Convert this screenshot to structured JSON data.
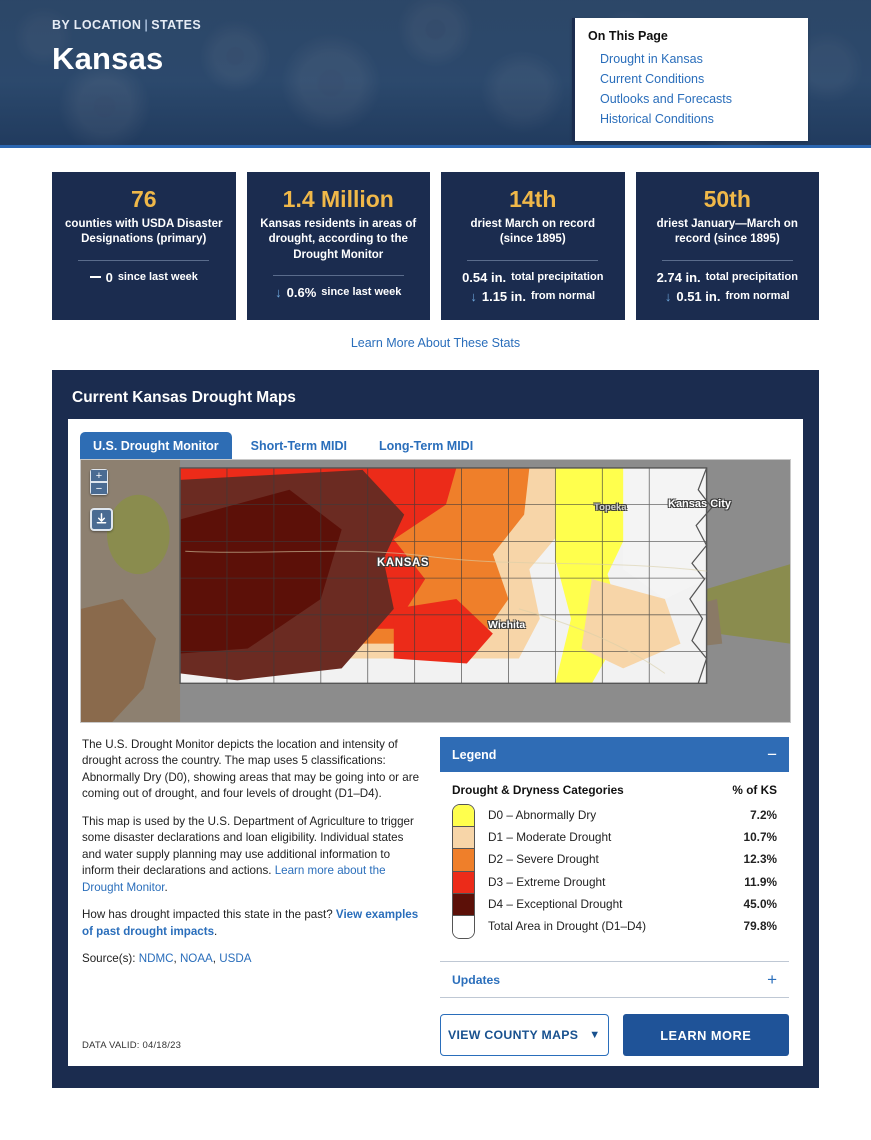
{
  "hero": {
    "eyebrow_a": "BY LOCATION",
    "eyebrow_sep": "|",
    "eyebrow_b": "STATES",
    "title": "Kansas",
    "on_this_page": {
      "title": "On This Page",
      "links": [
        "Drought in Kansas",
        "Current Conditions",
        "Outlooks and Forecasts",
        "Historical Conditions"
      ]
    }
  },
  "stats": {
    "cards": [
      {
        "number": "76",
        "label": "counties with USDA Disaster Designations (primary)",
        "rows": [
          {
            "icon": "no-change-dash",
            "value": "0",
            "sub": "since last week"
          }
        ]
      },
      {
        "number": "1.4 Million",
        "label": "Kansas residents in areas of drought, according to the Drought Monitor",
        "rows": [
          {
            "icon": "arrow-down",
            "value": "0.6%",
            "sub": "since last week"
          }
        ]
      },
      {
        "number": "14th",
        "label": "driest March on record (since 1895)",
        "rows": [
          {
            "icon": "none",
            "value": "0.54 in.",
            "sub": "total precipitation"
          },
          {
            "icon": "arrow-down",
            "value": "1.15 in.",
            "sub": "from normal"
          }
        ]
      },
      {
        "number": "50th",
        "label": "driest January—March on record (since 1895)",
        "rows": [
          {
            "icon": "none",
            "value": "2.74 in.",
            "sub": "total precipitation"
          },
          {
            "icon": "arrow-down",
            "value": "0.51 in.",
            "sub": "from normal"
          }
        ]
      }
    ],
    "learn_more_link": "Learn More About These Stats"
  },
  "map_card": {
    "title": "Current Kansas Drought Maps",
    "tabs": [
      {
        "label": "U.S. Drought Monitor",
        "active": true
      },
      {
        "label": "Short-Term MIDI",
        "active": false
      },
      {
        "label": "Long-Term MIDI",
        "active": false
      }
    ],
    "map": {
      "zoom_in": "+",
      "zoom_out": "−",
      "state_label": "KANSAS",
      "city_labels": [
        "Topeka",
        "Wichita",
        "Kansas City"
      ]
    },
    "paragraphs": {
      "p1": "The U.S. Drought Monitor depicts the location and intensity of drought across the country. The map uses 5 classifications: Abnormally Dry (D0), showing areas that may be going into or are coming out of drought, and four levels of drought (D1–D4).",
      "p2_a": "This map is used by the U.S. Department of Agriculture to trigger some disaster declarations and loan eligibility. Individual states and water supply planning may use additional information to inform their declarations and actions. ",
      "p2_link": "Learn more about the Drought Monitor",
      "p2_b": ".",
      "p3_a": "How has drought impacted this state in the past? ",
      "p3_link": "View examples of past drought impacts",
      "p3_b": ".",
      "sources_label": "Source(s): ",
      "sources": [
        "NDMC",
        "NOAA",
        "USDA"
      ]
    },
    "data_valid": "DATA VALID: 04/18/23",
    "legend": {
      "header": "Legend",
      "collapse_sign": "−",
      "col_category": "Drought & Dryness Categories",
      "col_pct": "% of KS",
      "rows": [
        {
          "label": "D0 – Abnormally Dry",
          "pct": "7.2%",
          "color": "#ffff4d"
        },
        {
          "label": "D1 – Moderate Drought",
          "pct": "10.7%",
          "color": "#f7d5a8"
        },
        {
          "label": "D2 – Severe Drought",
          "pct": "12.3%",
          "color": "#ef7f2a"
        },
        {
          "label": "D3 – Extreme Drought",
          "pct": "11.9%",
          "color": "#ec2b19"
        },
        {
          "label": "D4 – Exceptional Drought",
          "pct": "45.0%",
          "color": "#5c1008"
        },
        {
          "label": "Total Area in Drought (D1–D4)",
          "pct": "79.8%",
          "color": "#ffffff"
        }
      ]
    },
    "updates": {
      "label": "Updates",
      "expand_sign": "+"
    },
    "buttons": {
      "county_maps": "VIEW COUNTY MAPS",
      "county_maps_icon": "chevron-down-icon",
      "learn_more": "LEARN MORE"
    }
  }
}
